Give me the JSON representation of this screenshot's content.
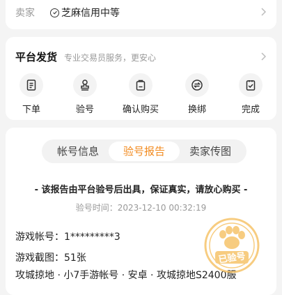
{
  "seller": {
    "label": "卖家",
    "credit": "芝麻信用中等"
  },
  "service": {
    "title": "平台发货",
    "subtitle": "专业交易员服务，更安心",
    "steps": [
      {
        "label": "下单",
        "icon": "document-icon"
      },
      {
        "label": "验号",
        "icon": "stamp-icon"
      },
      {
        "label": "确认购买",
        "icon": "bag-icon"
      },
      {
        "label": "换绑",
        "icon": "swap-icon"
      },
      {
        "label": "完成",
        "icon": "clipboard-check-icon"
      }
    ]
  },
  "report": {
    "tabs": [
      {
        "label": "帐号信息",
        "active": false
      },
      {
        "label": "验号报告",
        "active": true
      },
      {
        "label": "卖家传图",
        "active": false
      }
    ],
    "notice": "- 该报告由平台验号后出具，保证真实，请放心购买 -",
    "verify_time": "验号时间：2023-12-10 00:32:19",
    "account": "游戏帐号：1*********3",
    "screenshots": "游戏截图：51张",
    "tags": "攻城掠地 · 小7手游帐号 · 安卓 · 攻城掠地S2400服",
    "stamp_text": "已验号"
  },
  "colors": {
    "accent": "#f28a1e",
    "stamp": "#f6c46a"
  }
}
